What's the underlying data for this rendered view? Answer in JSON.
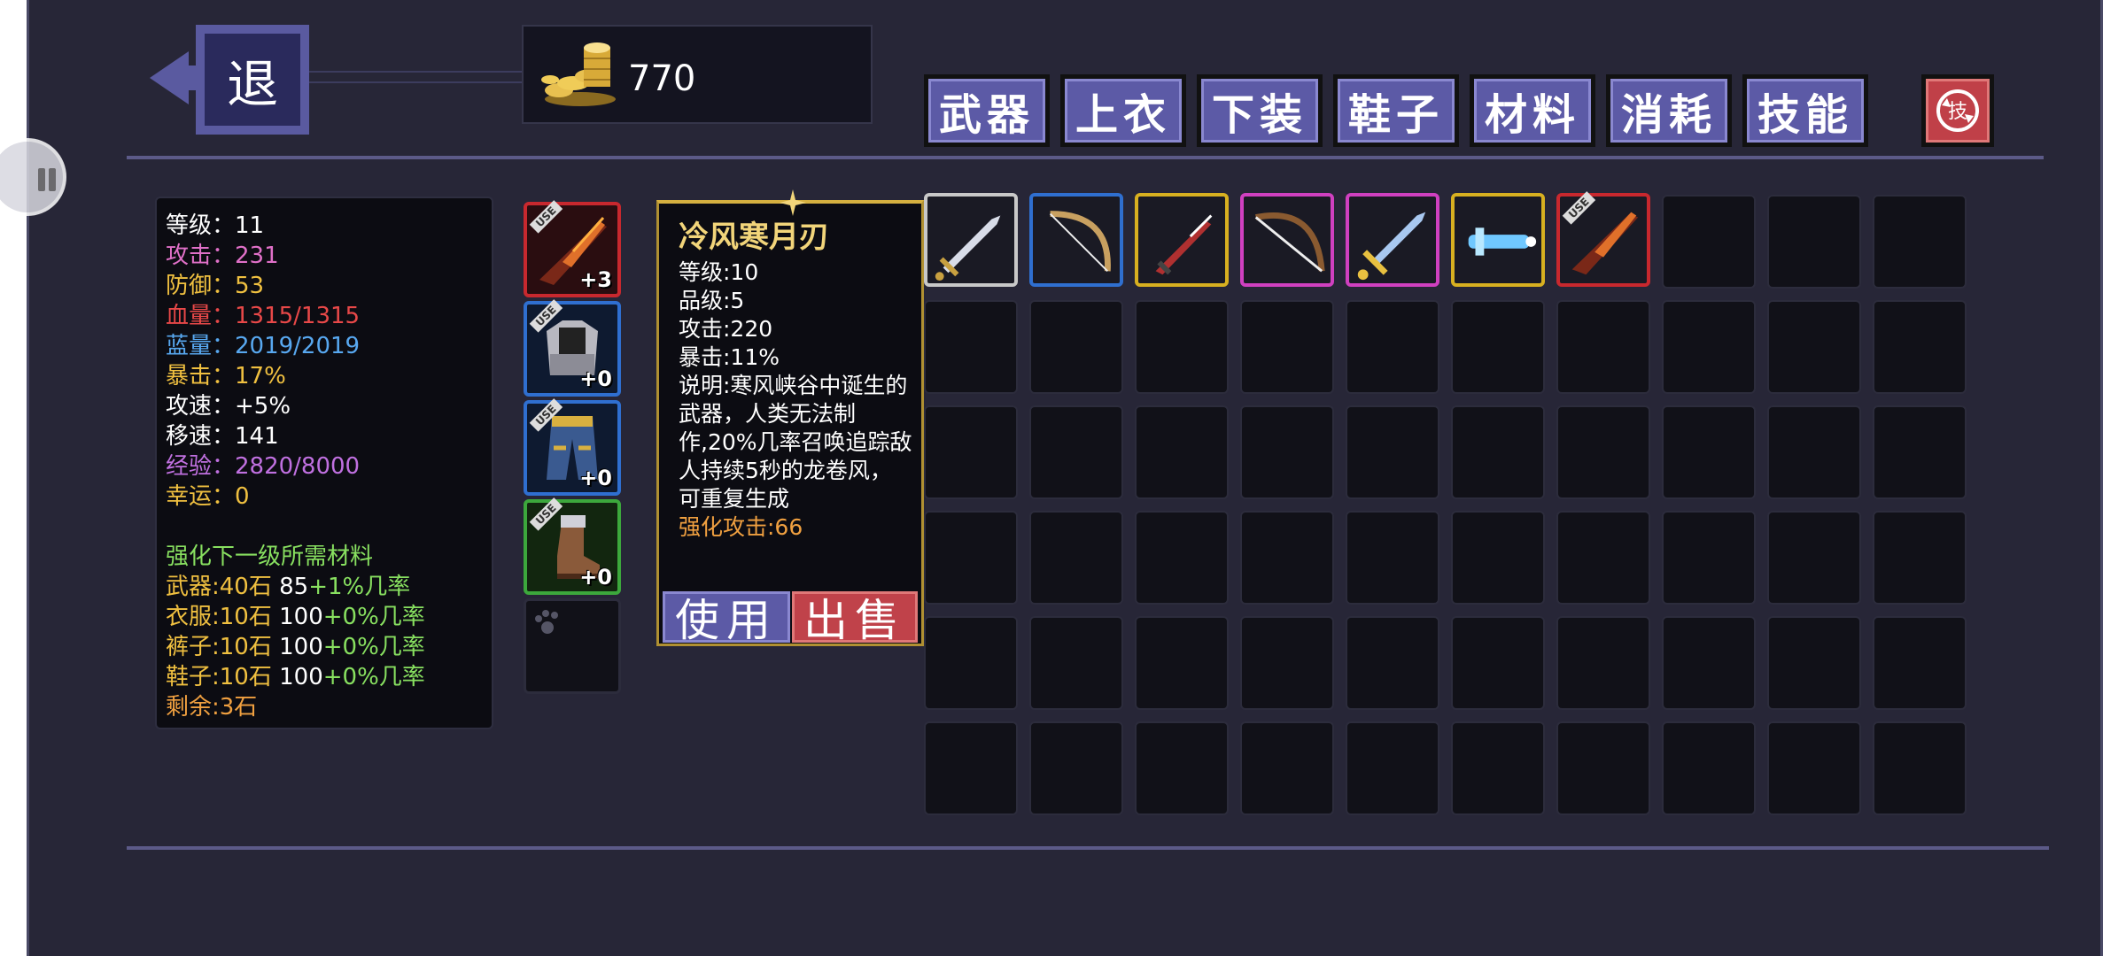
{
  "back": {
    "label": "退"
  },
  "gold": {
    "amount": "770"
  },
  "tabs": [
    "武器",
    "上衣",
    "下装",
    "鞋子",
    "材料",
    "消耗",
    "技能"
  ],
  "skill_reset": {
    "label": "技"
  },
  "stats": {
    "level": "等级：11",
    "attack": "攻击：231",
    "defense": "防御：53",
    "hp": "血量：1315/1315",
    "mp": "蓝量：2019/2019",
    "crit": "暴击：17%",
    "atk_speed": "攻速：+5%",
    "move_speed": "移速：141",
    "exp": "经验：2820/8000",
    "luck": "幸运：0"
  },
  "upgrade": {
    "heading": "强化下一级所需材料",
    "weapon": {
      "part": "武器:40石",
      "num": "85",
      "rate": "+1%几率"
    },
    "clothes": {
      "part": "衣服:10石",
      "num": "100",
      "rate": "+0%几率"
    },
    "pants": {
      "part": "裤子:10石",
      "num": "100",
      "rate": "+0%几率"
    },
    "shoes": {
      "part": "鞋子:10石",
      "num": "100",
      "rate": "+0%几率"
    },
    "remaining": "剩余:3石"
  },
  "equipped": [
    {
      "name": "weapon",
      "plus": "+3",
      "tag": "USE",
      "color": "#c8282e"
    },
    {
      "name": "armor",
      "plus": "+0",
      "tag": "USE",
      "color": "#2f6fd0"
    },
    {
      "name": "pants",
      "plus": "+0",
      "tag": "USE",
      "color": "#2f6fd0"
    },
    {
      "name": "boots",
      "plus": "+0",
      "tag": "USE",
      "color": "#3ca83c"
    },
    {
      "name": "pet",
      "plus": "",
      "tag": "",
      "color": "#2c2c3c"
    }
  ],
  "tooltip": {
    "title": "冷风寒月刃",
    "level": "等级:10",
    "grade": "品级:5",
    "attack": "攻击:220",
    "crit": "暴击:11%",
    "desc": "说明:寒风峡谷中诞生的武器，人类无法制作,20%几率召唤追踪敌人持续5秒的龙卷风，可重复生成",
    "bonus": "强化攻击:66",
    "use": "使用",
    "sell": "出售"
  },
  "inventory": [
    {
      "icon": "silver-sword",
      "rarity": "#c8c8c8"
    },
    {
      "icon": "wooden-bow",
      "rarity": "#2f6fd0"
    },
    {
      "icon": "crimson-dagger",
      "rarity": "#d8b020"
    },
    {
      "icon": "long-bow",
      "rarity": "#d040c0"
    },
    {
      "icon": "gold-hilt-sword",
      "rarity": "#d040c0"
    },
    {
      "icon": "ice-blade",
      "rarity": "#d8b020"
    },
    {
      "icon": "flame-blade",
      "rarity": "#c8282e",
      "tag": "USE"
    }
  ],
  "colors": {
    "white": "#ffffff",
    "attack": "#e070c8",
    "defense": "#f0c040",
    "hp": "#e84848",
    "mp": "#58a8f0",
    "crit": "#f0c040",
    "exp": "#c070e0",
    "luck": "#f0c040",
    "green": "#88e060",
    "yellow": "#f0c040",
    "orange": "#f0a040"
  }
}
